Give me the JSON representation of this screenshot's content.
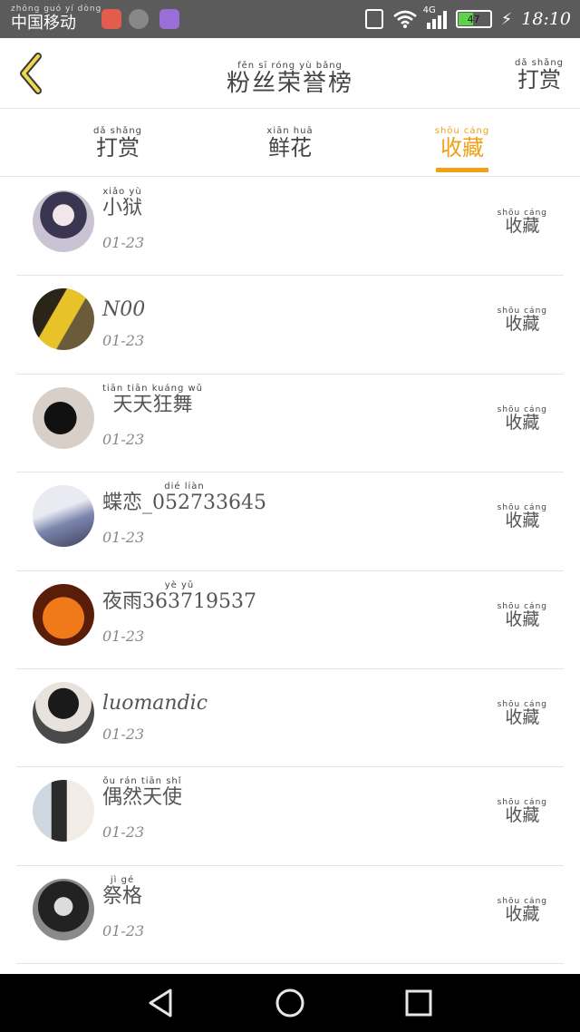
{
  "status_bar": {
    "carrier_pinyin": "zhōng guó  yí  dòng",
    "carrier": "中国移动",
    "network": "4G",
    "battery": "47",
    "time": "18:10"
  },
  "header": {
    "title_pinyin": "fěn  sī  róng  yù  bǎng",
    "title": "粉丝荣誉榜",
    "action_pinyin": "dǎ  shǎng",
    "action": "打赏"
  },
  "tabs": [
    {
      "pinyin": "dǎ  shǎng",
      "label": "打赏",
      "active": false
    },
    {
      "pinyin": "xiān  huā",
      "label": "鲜花",
      "active": false
    },
    {
      "pinyin": "shōu  cáng",
      "label": "收藏",
      "active": true
    }
  ],
  "accent_color": "#f0a116",
  "list": [
    {
      "name_pinyin": "xiǎo  yù",
      "name": "小狱",
      "date": "01-23",
      "action_pinyin": "shōu cáng",
      "action": "收藏"
    },
    {
      "name_pinyin": "",
      "name": "N00",
      "date": "01-23",
      "action_pinyin": "shōu cáng",
      "action": "收藏"
    },
    {
      "name_pinyin": "tiān  tiān  kuáng  wǔ",
      "name": "天天狂舞",
      "date": "01-23",
      "action_pinyin": "shōu cáng",
      "action": "收藏"
    },
    {
      "name_pinyin": "dié   liàn",
      "name": "蝶恋_052733645",
      "date": "01-23",
      "action_pinyin": "shōu cáng",
      "action": "收藏"
    },
    {
      "name_pinyin": "yè   yǔ",
      "name": "夜雨363719537",
      "date": "01-23",
      "action_pinyin": "shōu cáng",
      "action": "收藏"
    },
    {
      "name_pinyin": "",
      "name": "luomandic",
      "date": "01-23",
      "action_pinyin": "shōu cáng",
      "action": "收藏"
    },
    {
      "name_pinyin": "ǒu   rán  tiān  shǐ",
      "name": "偶然天使",
      "date": "01-23",
      "action_pinyin": "shōu cáng",
      "action": "收藏"
    },
    {
      "name_pinyin": "jì   gé",
      "name": "祭格",
      "date": "01-23",
      "action_pinyin": "shōu cáng",
      "action": "收藏"
    }
  ],
  "nav_bar": {
    "back": "back-icon",
    "home": "home-icon",
    "recent": "recent-apps-icon"
  }
}
